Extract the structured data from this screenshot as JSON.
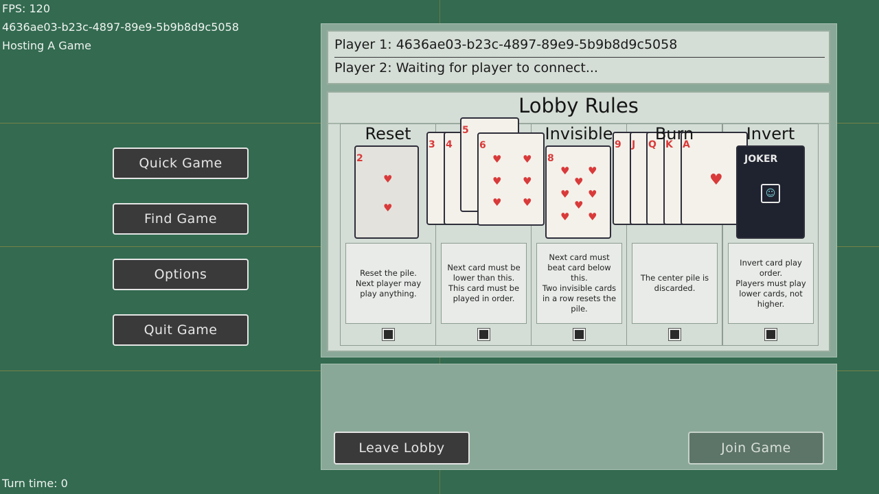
{
  "hud": {
    "fps": "FPS: 120",
    "player_id": "4636ae03-b23c-4897-89e9-5b9b8d9c5058",
    "status": "Hosting A Game",
    "turn_time": "Turn time: 0"
  },
  "menu": {
    "quick_game": "Quick Game",
    "find_game": "Find Game",
    "options": "Options",
    "quit_game": "Quit Game"
  },
  "lobby": {
    "player1": "Player 1: 4636ae03-b23c-4897-89e9-5b9b8d9c5058",
    "player2": "Player 2: Waiting for player to connect...",
    "rules_title": "Lobby Rules",
    "rules": [
      {
        "name": "Reset",
        "desc": "Reset the pile.\nNext player may play anything."
      },
      {
        "name": "",
        "desc": "Next card must be lower than this. This card must be played in order."
      },
      {
        "name": "Invisible",
        "desc": "Next card must beat card below this.\nTwo invisible cards in a row resets the pile."
      },
      {
        "name": "Burn",
        "desc": "The center pile is discarded."
      },
      {
        "name": "Invert",
        "desc": "Invert card play order.\nPlayers must play lower cards, not higher."
      }
    ],
    "cards": {
      "reset_rank": "2",
      "ranks_low": [
        "3",
        "4",
        "5",
        "6"
      ],
      "invisible_rank": "8",
      "ranks_high": [
        "9",
        "J",
        "Q",
        "K",
        "A"
      ],
      "joker_text": "JOKER"
    },
    "leave_label": "Leave Lobby",
    "join_label": "Join Game"
  },
  "colors": {
    "background": "#336a50",
    "panel": "#8aa898",
    "button_dark": "#3a3a3a",
    "card_red": "#d93a3a"
  }
}
